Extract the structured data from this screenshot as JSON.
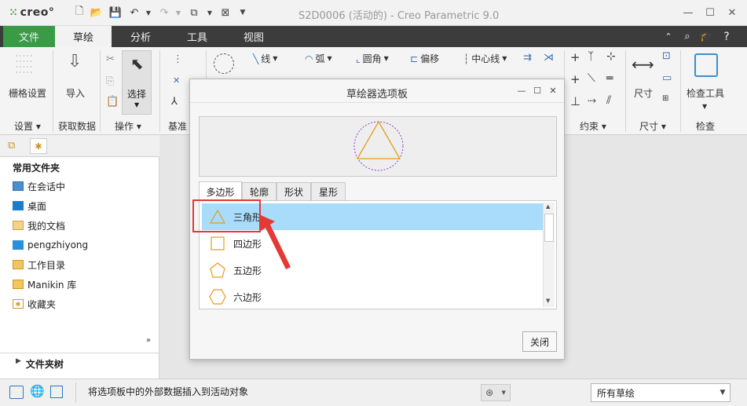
{
  "app": {
    "logo": "creo°",
    "title": "S2D0006 (活动的) - Creo Parametric 9.0"
  },
  "tabs": [
    "文件",
    "草绘",
    "分析",
    "工具",
    "视图"
  ],
  "ribbon": {
    "grid_settings": "栅格设置",
    "import": "导入",
    "select": "选择",
    "line": "线",
    "arc": "弧",
    "fillet": "圆角",
    "offset": "偏移",
    "centerline": "中心线",
    "dimension": "尺寸",
    "inspect_tools": "检查工具",
    "groups": {
      "settings": "设置",
      "get_data": "获取数据",
      "operations": "操作",
      "datum": "基准",
      "constrain": "约束",
      "dimension": "尺寸",
      "inspect": "检查"
    }
  },
  "left_panel": {
    "common_folders": "常用文件夹",
    "items": [
      "在会话中",
      "桌面",
      "我的文档",
      "pengzhiyong",
      "工作目录",
      "Manikin 库",
      "收藏夹"
    ],
    "folder_tree": "文件夹树"
  },
  "dialog": {
    "title": "草绘器选项板",
    "tabs": [
      "多边形",
      "轮廓",
      "形状",
      "星形"
    ],
    "items": [
      "三角形",
      "四边形",
      "五边形",
      "六边形"
    ],
    "close": "关闭"
  },
  "status": {
    "message": "将选项板中的外部数据插入到活动对象",
    "filter": "所有草绘"
  },
  "colors": {
    "accent_green": "#3a9b46",
    "selection": "#a9dcfa",
    "shape_orange": "#e59a1f",
    "highlight_red": "#e53935"
  }
}
